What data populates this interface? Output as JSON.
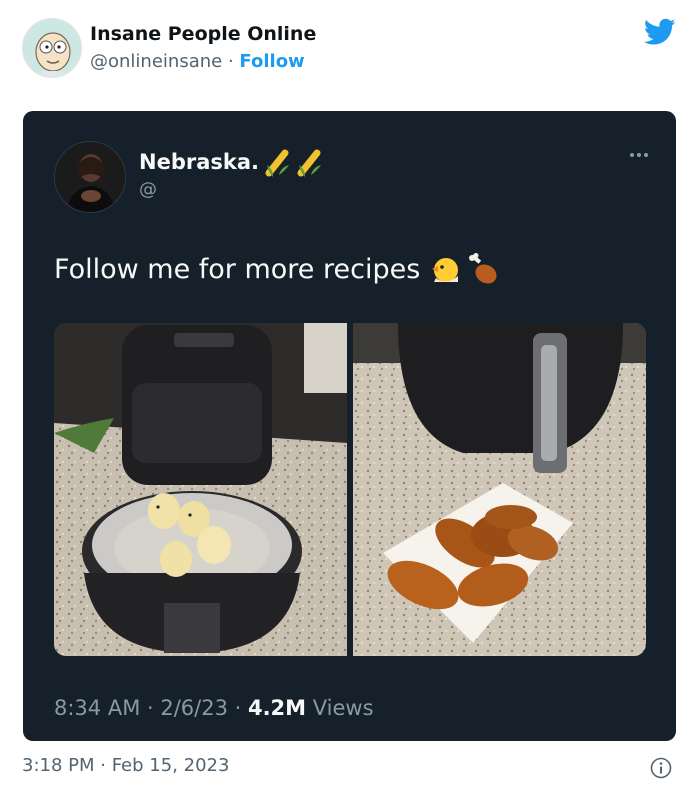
{
  "outer": {
    "name": "Insane People Online",
    "handle": "@onlineinsane",
    "separator": "·",
    "follow_label": "Follow",
    "footer_time": "3:18 PM · Feb 15, 2023",
    "icons": {
      "avatar": "cartoon-avatar",
      "brand": "twitter-bird-icon",
      "info": "info-icon"
    },
    "colors": {
      "accent": "#1d9bf0",
      "text": "#0f1419",
      "muted": "#536471"
    }
  },
  "embedded": {
    "name": "Nebraska.",
    "name_emoji": "corn-icon",
    "handle": "@",
    "text": "Follow me for more recipes",
    "text_emoji": [
      "hatching-chick-icon",
      "poultry-leg-icon"
    ],
    "meta_time": "8:34 AM · 2/6/23 · ",
    "meta_views_count": "4.2M",
    "meta_views_label": " Views",
    "photos": [
      {
        "subject": "chicks-in-air-fryer-basket"
      },
      {
        "subject": "fried-chicken-on-paper-tray"
      }
    ],
    "colors": {
      "background": "#15202b",
      "text": "#f7f9f9",
      "muted": "#8b98a5"
    }
  }
}
